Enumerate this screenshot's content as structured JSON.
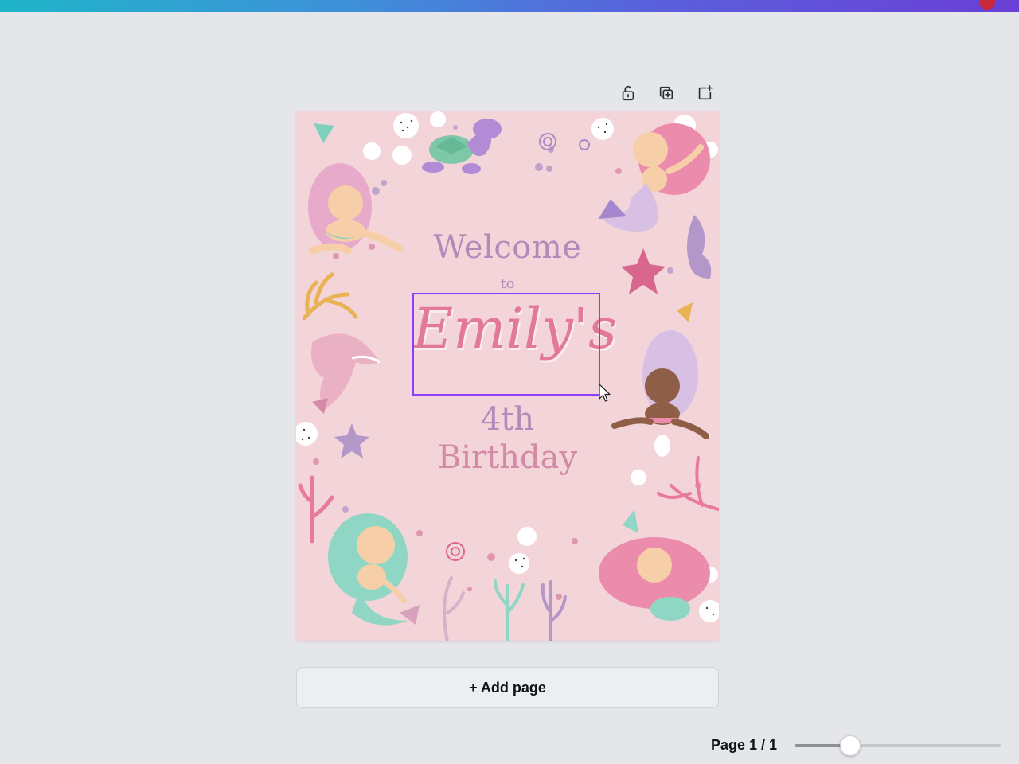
{
  "top_bar": {
    "accent_colors": [
      "#1fb5c9",
      "#5a5fdc",
      "#6a3fd6"
    ]
  },
  "page_toolbar": {
    "icons": [
      "unlock-icon",
      "duplicate-page-icon",
      "add-page-icon"
    ]
  },
  "design": {
    "welcome": "Welcome",
    "to": "to",
    "name": "Emily's",
    "age": "4th",
    "event": "Birthday",
    "background_color": "#f3d4d9",
    "selection_color": "#8b3dff"
  },
  "add_page_button": {
    "label": "+ Add page"
  },
  "footer": {
    "page_indicator": "Page 1 / 1",
    "zoom_fraction": 0.27
  }
}
